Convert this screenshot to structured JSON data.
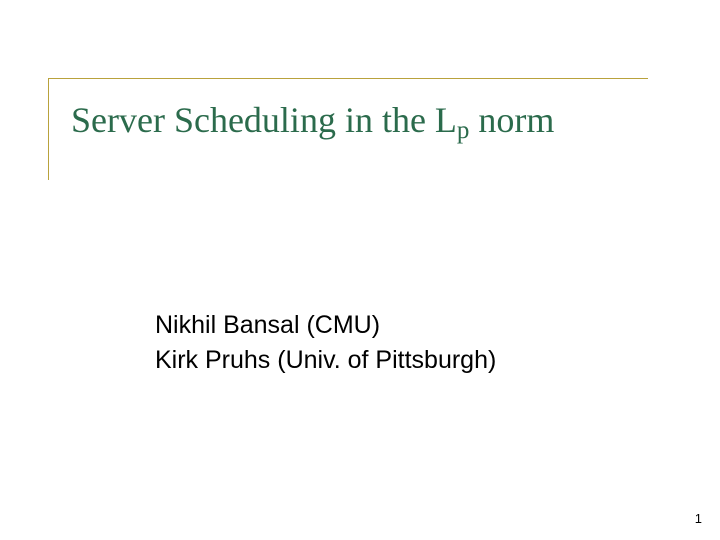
{
  "title": {
    "pre": "Server Scheduling in the L",
    "sub": "p",
    "post": " norm"
  },
  "authors": {
    "line1": "Nikhil Bansal (CMU)",
    "line2": "Kirk Pruhs   (Univ. of Pittsburgh)"
  },
  "page_number": "1"
}
